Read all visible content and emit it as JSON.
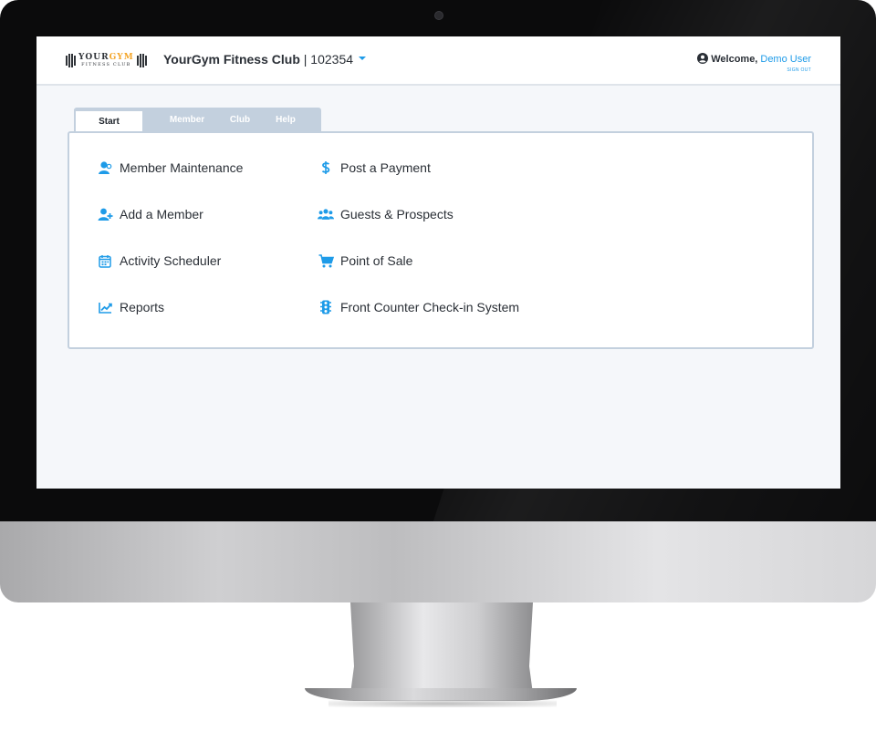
{
  "header": {
    "logo": {
      "main_prefix": "YOUR",
      "main_accent": "GYM",
      "sub": "FITNESS CLUB"
    },
    "club_name": "YourGym Fitness Club",
    "club_separator": " | ",
    "club_id": "102354",
    "welcome_label": "Welcome,",
    "user_name": "Demo User",
    "sign_out": "SIGN OUT"
  },
  "tabs": [
    {
      "label": "Start",
      "active": true
    },
    {
      "label": "Member",
      "active": false
    },
    {
      "label": "Club",
      "active": false
    },
    {
      "label": "Help",
      "active": false
    }
  ],
  "menu": {
    "left": [
      {
        "label": "Member Maintenance",
        "icon": "member-maintenance-icon"
      },
      {
        "label": "Add a Member",
        "icon": "add-member-icon"
      },
      {
        "label": "Activity Scheduler",
        "icon": "calendar-icon"
      },
      {
        "label": "Reports",
        "icon": "chart-line-icon"
      }
    ],
    "right": [
      {
        "label": "Post a Payment",
        "icon": "dollar-icon"
      },
      {
        "label": "Guests & Prospects",
        "icon": "users-icon"
      },
      {
        "label": "Point of Sale",
        "icon": "cart-icon"
      },
      {
        "label": "Front Counter Check-in System",
        "icon": "traffic-light-icon"
      }
    ]
  },
  "colors": {
    "accent": "#1e9be8",
    "logo_accent": "#f4a62a",
    "tab_bar": "#c3d0de",
    "text": "#2a2f36"
  }
}
